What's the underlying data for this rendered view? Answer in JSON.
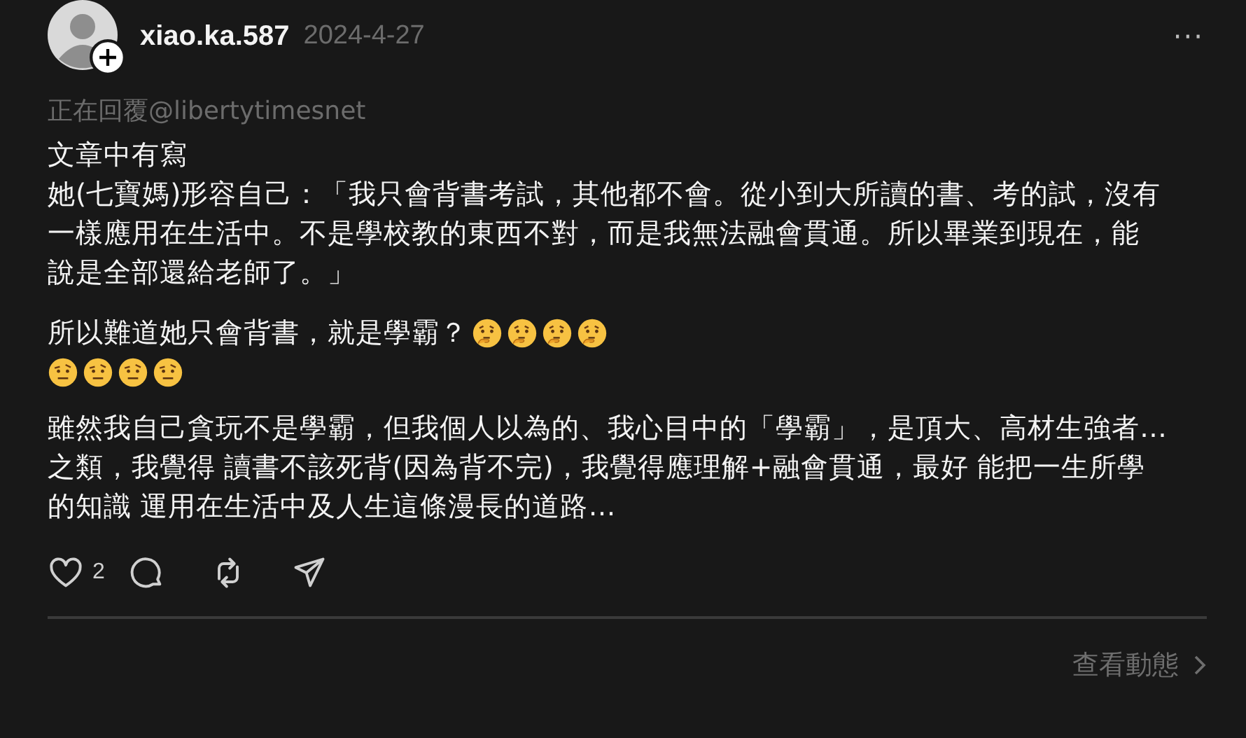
{
  "post": {
    "author": "xiao.ka.587",
    "date": "2024-4-27",
    "more_icon": "···",
    "reply_to": "正在回覆@libertytimesnet",
    "paragraphs": [
      {
        "lines": [
          "文章中有寫",
          "她(七寶媽)形容自己：「我只會背書考試，其他都不會。從小到大所讀的書、考的試，沒有",
          "一樣應用在生活中。不是學校教的東西不對，而是我無法融會貫通。所以畢業到現在，能",
          "說是全部還給老師了。」"
        ]
      },
      {
        "lines": [
          "所以難道她只會背書，就是學霸？"
        ],
        "emoji_lines": [
          [
            {
              "kind": "thinking"
            },
            {
              "kind": "thinking"
            },
            {
              "kind": "thinking"
            },
            {
              "kind": "thinking"
            }
          ],
          [
            {
              "kind": "raised-eyebrow"
            },
            {
              "kind": "raised-eyebrow"
            },
            {
              "kind": "raised-eyebrow"
            },
            {
              "kind": "raised-eyebrow"
            }
          ]
        ]
      },
      {
        "lines": [
          "雖然我自己貪玩不是學霸，但我個人以為的、我心目中的「學霸」，是頂大、高材生強者…",
          "之類，我覺得 讀書不該死背(因為背不完)，我覺得應理解+融會貫通，最好 能把一生所學",
          "的知識 運用在生活中及人生這條漫長的道路…"
        ]
      }
    ],
    "actions": [
      {
        "kind": "like",
        "count": "2"
      },
      {
        "kind": "comment"
      },
      {
        "kind": "repost"
      },
      {
        "kind": "share"
      }
    ],
    "view_activity": "查看動態"
  }
}
